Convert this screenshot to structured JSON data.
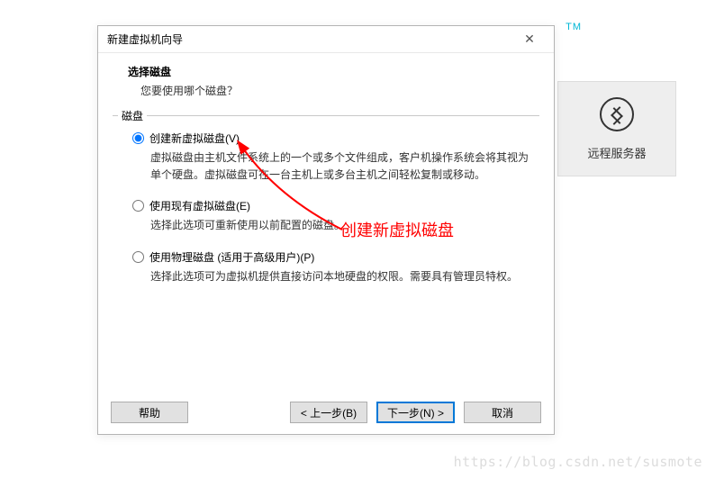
{
  "tm": "TM",
  "remote": {
    "label": "远程服务器"
  },
  "dialog": {
    "title": "新建虚拟机向导",
    "header_title": "选择磁盘",
    "header_sub": "您要使用哪个磁盘？",
    "group_label": "磁盘",
    "options": [
      {
        "label": "创建新虚拟磁盘(V)",
        "checked": true,
        "desc": "虚拟磁盘由主机文件系统上的一个或多个文件组成，客户机操作系统会将其视为单个硬盘。虚拟磁盘可在一台主机上或多台主机之间轻松复制或移动。"
      },
      {
        "label": "使用现有虚拟磁盘(E)",
        "checked": false,
        "desc": "选择此选项可重新使用以前配置的磁盘。"
      },
      {
        "label": "使用物理磁盘 (适用于高级用户)(P)",
        "checked": false,
        "desc": "选择此选项可为虚拟机提供直接访问本地硬盘的权限。需要具有管理员特权。"
      }
    ],
    "buttons": {
      "help": "帮助",
      "back": "< 上一步(B)",
      "next": "下一步(N) >",
      "cancel": "取消"
    }
  },
  "annotation": "创建新虚拟磁盘",
  "watermark": "https://blog.csdn.net/susmote"
}
